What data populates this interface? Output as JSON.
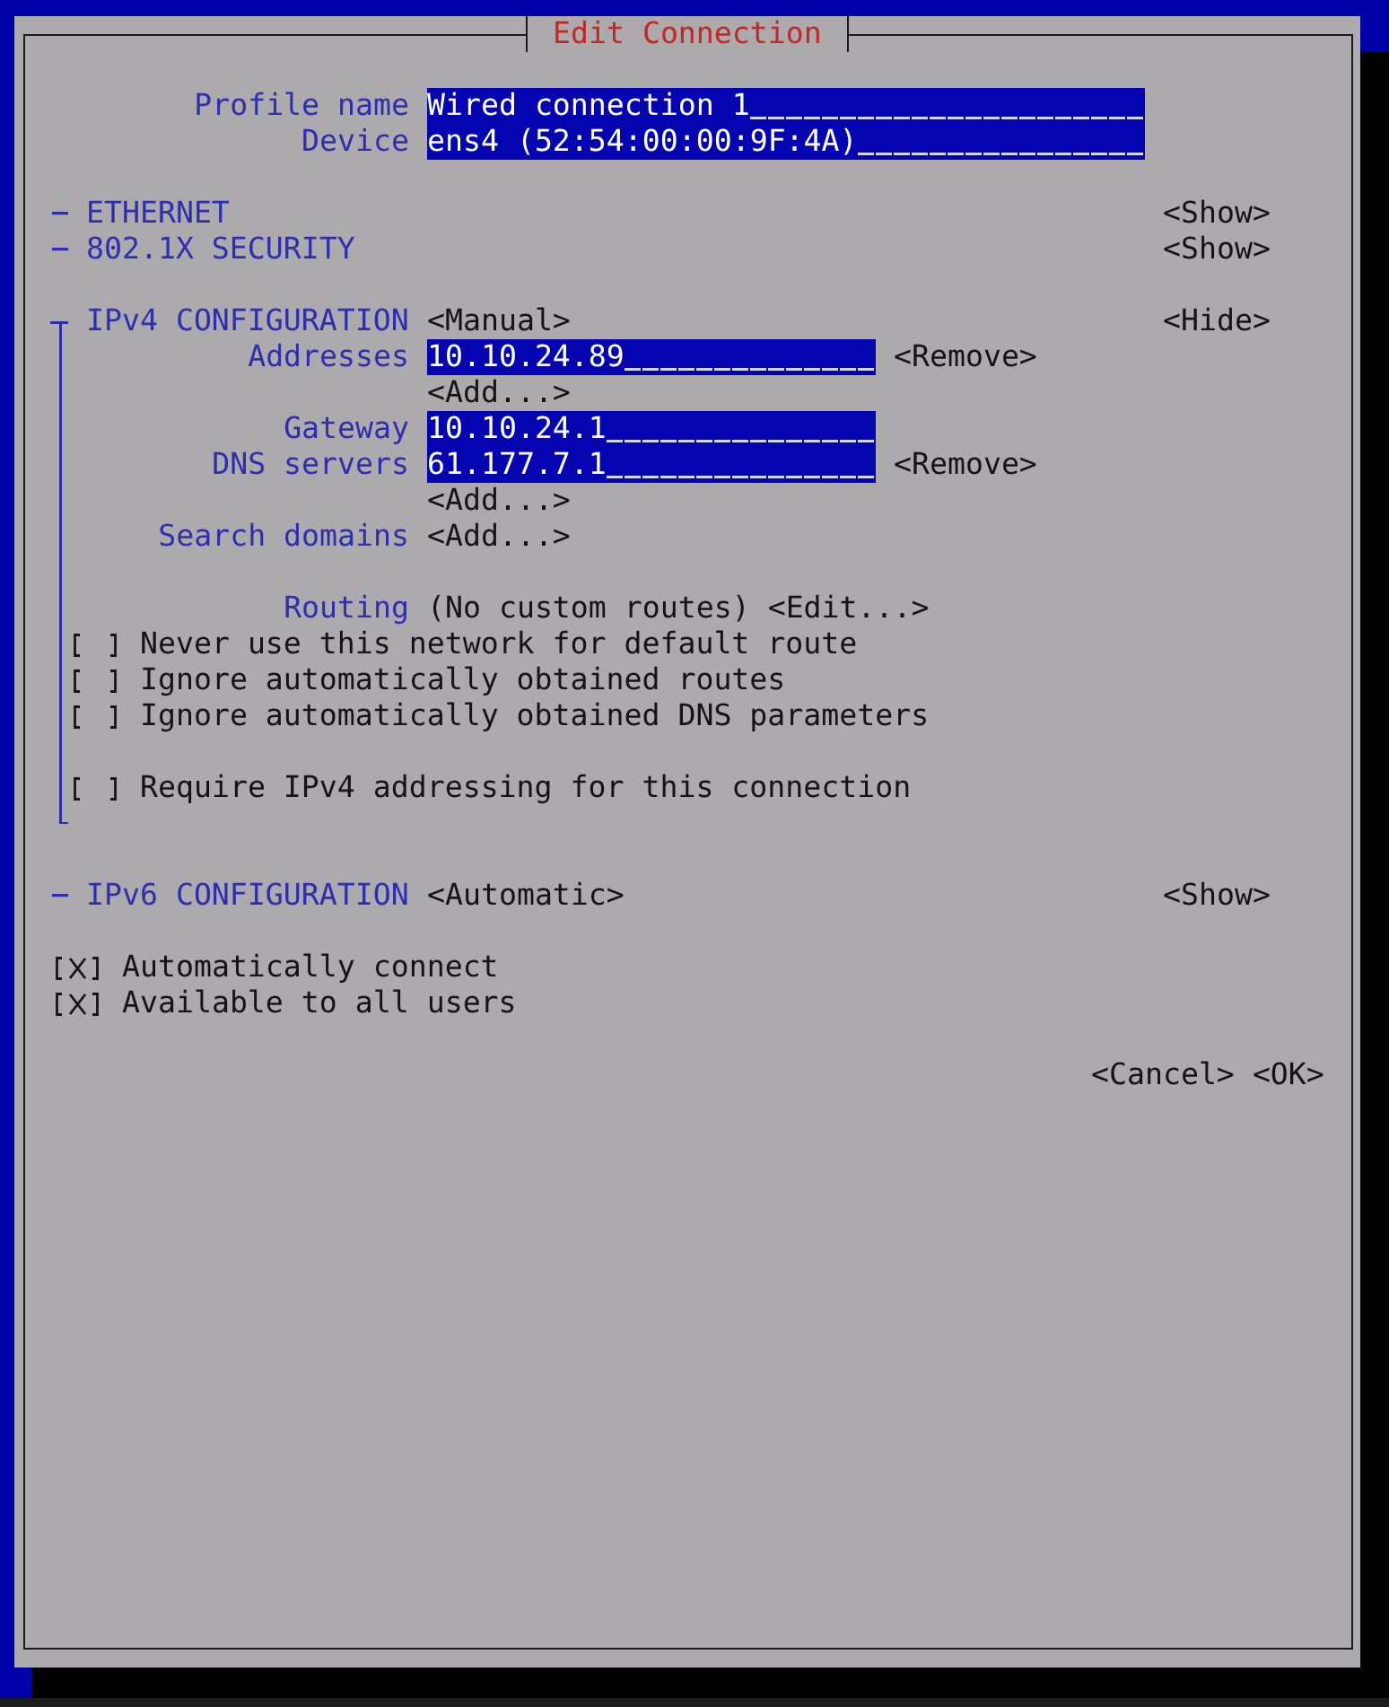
{
  "window": {
    "title": "Edit Connection"
  },
  "profile": [
    {
      "label": "Profile name",
      "value": "Wired connection 1"
    },
    {
      "label": "Device",
      "value": "ens4 (52:54:00:00:9F:4A)"
    }
  ],
  "sections": [
    {
      "title": "ETHERNET",
      "expanded": false,
      "toggle": "<Show>"
    },
    {
      "title": "802.1X SECURITY",
      "expanded": false,
      "toggle": "<Show>"
    },
    {
      "title": "IPv4 CONFIGURATION",
      "mode": "<Manual>",
      "expanded": true,
      "toggle": "<Hide>",
      "rows": [
        {
          "kind": "field",
          "label": "Addresses",
          "value": "10.10.24.89",
          "action": "<Remove>"
        },
        {
          "kind": "add",
          "action": "<Add...>"
        },
        {
          "kind": "field",
          "label": "Gateway",
          "value": "10.10.24.1"
        },
        {
          "kind": "field",
          "label": "DNS servers",
          "value": "61.177.7.1",
          "action": "<Remove>"
        },
        {
          "kind": "add",
          "action": "<Add...>"
        },
        {
          "kind": "add",
          "label": "Search domains",
          "action": "<Add...>"
        }
      ],
      "routing": {
        "label": "Routing",
        "value": "(No custom routes)",
        "action": "<Edit...>"
      },
      "route_options": [
        {
          "label": "Never use this network for default route",
          "checked": false
        },
        {
          "label": "Ignore automatically obtained routes",
          "checked": false
        },
        {
          "label": "Ignore automatically obtained DNS parameters",
          "checked": false
        }
      ],
      "require_option": {
        "label": "Require IPv4 addressing for this connection",
        "checked": false
      }
    },
    {
      "title": "IPv6 CONFIGURATION",
      "mode": "<Automatic>",
      "expanded": false,
      "toggle": "<Show>"
    }
  ],
  "options": [
    {
      "label": "Automatically connect",
      "checked": true
    },
    {
      "label": "Available to all users",
      "checked": true
    }
  ],
  "buttons": [
    "<Cancel>",
    "<OK>"
  ]
}
